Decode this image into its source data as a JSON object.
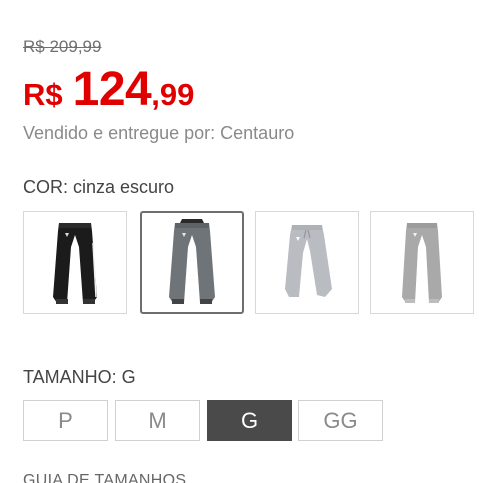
{
  "price": {
    "old": "R$ 209,99",
    "currency": "R$",
    "integer": "124",
    "decimal": ",99",
    "accent_color": "#e10000"
  },
  "seller": "Vendido e entregue por: Centauro",
  "color": {
    "label": "COR: cinza escuro",
    "swatches": [
      {
        "icon": "black-jogger-pants-icon",
        "fill": "#1b1b1b",
        "selected": false
      },
      {
        "icon": "dark-gray-jogger-pants-icon",
        "fill": "#6f7478",
        "selected": true
      },
      {
        "icon": "light-gray-jogger-pants-icon",
        "fill": "#b9bcc0",
        "selected": false
      },
      {
        "icon": "heather-gray-jogger-pants-icon",
        "fill": "#a9a9a9",
        "selected": false
      }
    ]
  },
  "size": {
    "label": "TAMANHO: G",
    "options": [
      "P",
      "M",
      "G",
      "GG"
    ],
    "selected": "G"
  },
  "guide_label": "GUIA DE TAMANHOS"
}
